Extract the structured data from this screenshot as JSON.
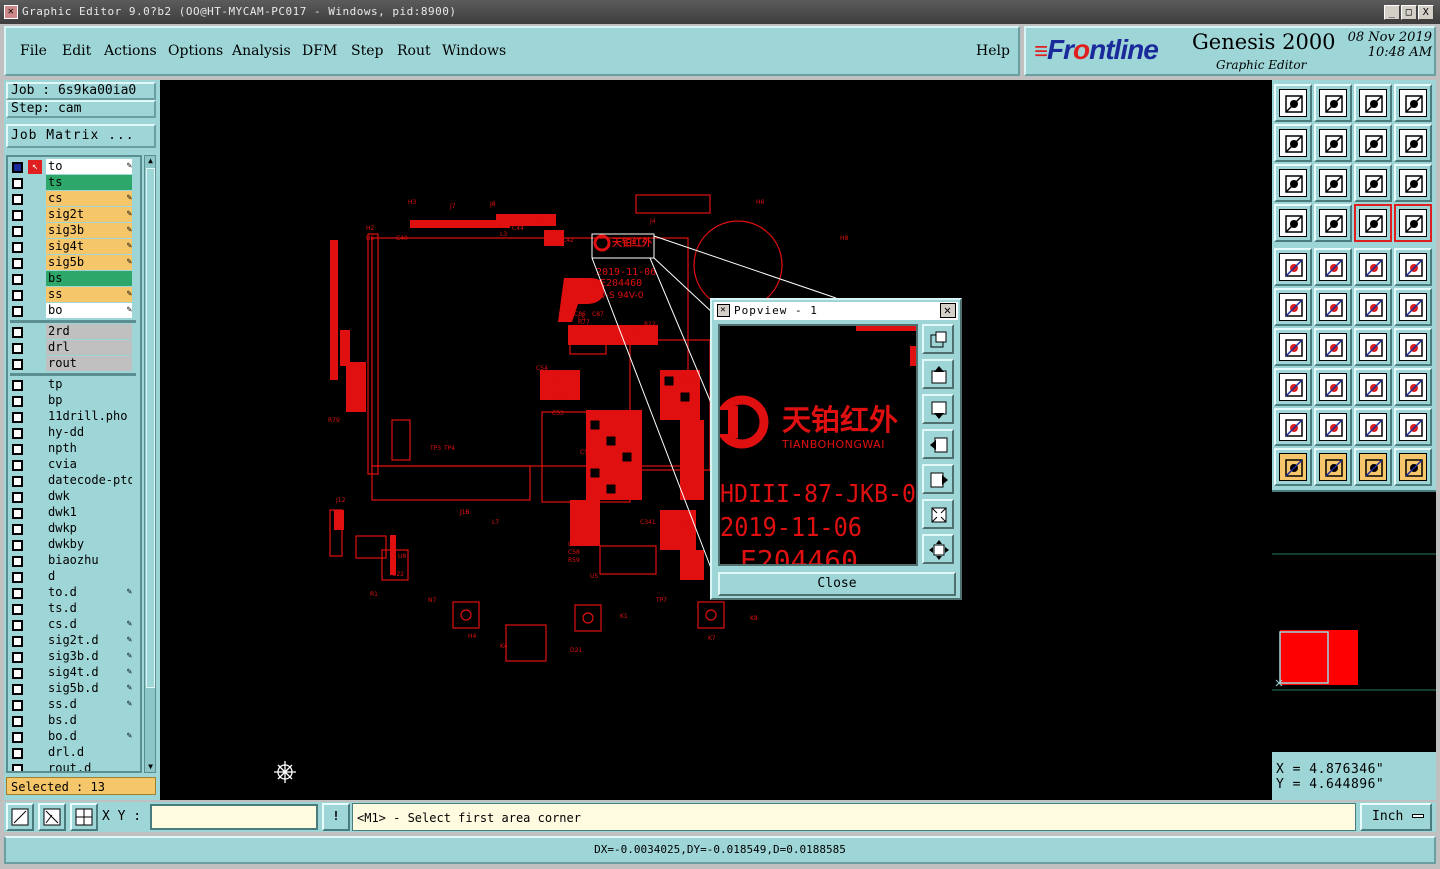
{
  "window": {
    "title": "Graphic Editor 9.0?b2 (OO@HT-MYCAM-PC017 - Windows, pid:8900)",
    "buttons": [
      "_",
      "□",
      "X"
    ]
  },
  "menu": {
    "items": [
      "File",
      "Edit",
      "Actions",
      "Options",
      "Analysis",
      "DFM",
      "Step",
      "Rout",
      "Windows"
    ],
    "help": "Help"
  },
  "brand": {
    "logo_prefix": "Fr",
    "logo_accent": "o",
    "logo_suffix": "ntline",
    "product": "Genesis 2000",
    "subtitle": "Graphic Editor",
    "date": "08 Nov 2019",
    "time": "10:48 AM"
  },
  "job": {
    "job_label": "Job : 6s9ka00ia0",
    "step_label": "Step: cam",
    "matrix_button": "Job Matrix ..."
  },
  "layers": {
    "group1": [
      {
        "name": "to",
        "color": "#ffffff",
        "editable": true
      },
      {
        "name": "ts",
        "color": "#2ea86a",
        "editable": false
      },
      {
        "name": "cs",
        "color": "#f5c66a",
        "editable": true
      },
      {
        "name": "sig2t",
        "color": "#f5c66a",
        "editable": true
      },
      {
        "name": "sig3b",
        "color": "#f5c66a",
        "editable": true
      },
      {
        "name": "sig4t",
        "color": "#f5c66a",
        "editable": true
      },
      {
        "name": "sig5b",
        "color": "#f5c66a",
        "editable": true
      },
      {
        "name": "bs",
        "color": "#2ea86a",
        "editable": false
      },
      {
        "name": "ss",
        "color": "#f5c66a",
        "editable": true
      },
      {
        "name": "bo",
        "color": "#ffffff",
        "editable": true
      }
    ],
    "group2": [
      {
        "name": "2rd",
        "color": "#c0c0c0"
      },
      {
        "name": "drl",
        "color": "#c0c0c0"
      },
      {
        "name": "rout",
        "color": "#c0c0c0"
      }
    ],
    "group3": [
      {
        "name": "tp",
        "editable": false
      },
      {
        "name": "bp",
        "editable": false
      },
      {
        "name": "11drill.pho",
        "editable": false
      },
      {
        "name": "hy-dd",
        "editable": false
      },
      {
        "name": "npth",
        "editable": false
      },
      {
        "name": "cvia",
        "editable": false
      },
      {
        "name": "datecode-pto",
        "editable": false
      },
      {
        "name": "dwk",
        "editable": false
      },
      {
        "name": "dwk1",
        "editable": false
      },
      {
        "name": "dwkp",
        "editable": false
      },
      {
        "name": "dwkby",
        "editable": false
      },
      {
        "name": "biaozhu",
        "editable": false
      },
      {
        "name": "d",
        "editable": false
      },
      {
        "name": "to.d",
        "editable": true
      },
      {
        "name": "ts.d",
        "editable": false
      },
      {
        "name": "cs.d",
        "editable": true
      },
      {
        "name": "sig2t.d",
        "editable": true
      },
      {
        "name": "sig3b.d",
        "editable": true
      },
      {
        "name": "sig4t.d",
        "editable": true
      },
      {
        "name": "sig5b.d",
        "editable": true
      },
      {
        "name": "ss.d",
        "editable": true
      },
      {
        "name": "bs.d",
        "editable": false
      },
      {
        "name": "bo.d",
        "editable": true
      },
      {
        "name": "drl.d",
        "editable": false
      },
      {
        "name": "rout.d",
        "editable": false
      }
    ]
  },
  "selected": "Selected : 13",
  "popview": {
    "title": "Popview - 1",
    "brand_cn": "天铂红外",
    "brand_en": "TIANBOHONGWAI",
    "line1": "HDIII-87-JKB-0",
    "line2": "2019-11-06",
    "line3": "E204460",
    "close": "Close"
  },
  "board": {
    "label_brand": "天铂红外",
    "label_date": "2019-11-06",
    "label_code": "E204460",
    "labels": [
      "H3",
      "J7",
      "J8",
      "C45",
      "C47",
      "C44",
      "L3",
      "R8",
      "C40",
      "H2",
      "U6",
      "J4",
      "C42",
      "H8",
      "H6",
      "L5",
      "C86",
      "C87",
      "R77",
      "R22",
      "C88",
      "C54",
      "C53",
      "D3",
      "C56",
      "C59",
      "J15",
      "L7",
      "U5",
      "TP3",
      "TP4",
      "J12",
      "R79",
      "J16",
      "C57",
      "C58",
      "R59",
      "C341",
      "C80",
      "C18",
      "H4",
      "K1",
      "K4",
      "K7",
      "K8",
      "D21",
      "N7",
      "TP7",
      "U8",
      "U22",
      "R1"
    ],
    "trace_color": "#e01010"
  },
  "coords": {
    "x": "X = 4.876346\"",
    "y": "Y = 4.644896\""
  },
  "bottom": {
    "xy_label": "X Y :",
    "xy_value": "",
    "bang": "!",
    "prompt": "<M1> - Select first area corner",
    "unit": "Inch"
  },
  "status": "DX=-0.0034025,DY=-0.018549,D=0.0188585"
}
